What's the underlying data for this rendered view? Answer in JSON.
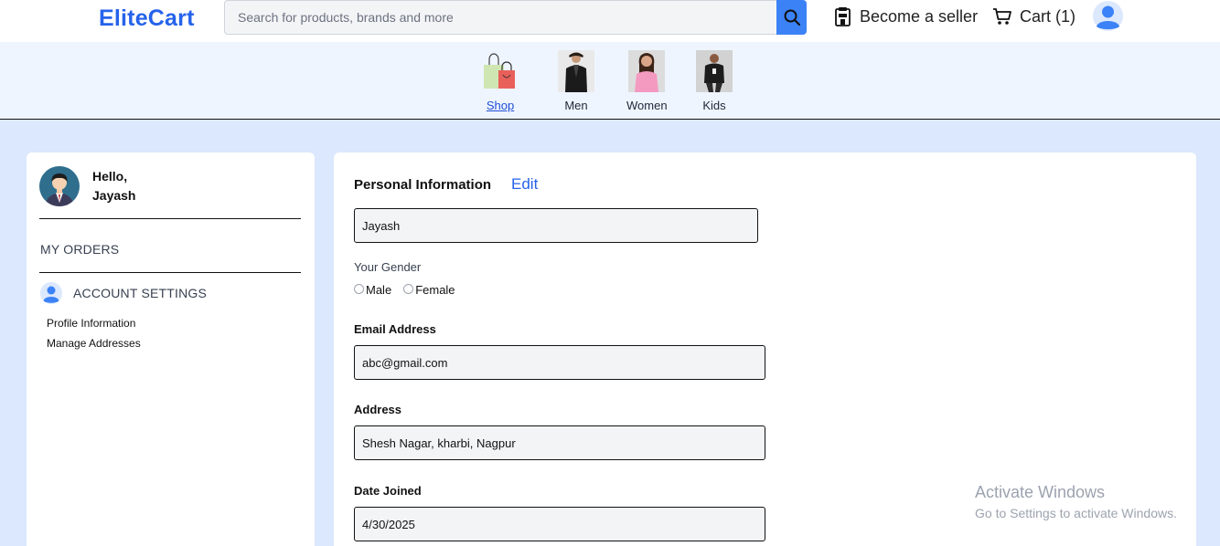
{
  "header": {
    "logo": "EliteCart",
    "search_placeholder": "Search for products, brands and more",
    "seller_label": "Become a seller",
    "cart_label": "Cart (1)"
  },
  "categories": [
    {
      "label": "Shop",
      "active": true
    },
    {
      "label": "Men"
    },
    {
      "label": "Women"
    },
    {
      "label": "Kids"
    }
  ],
  "sidebar": {
    "greeting": "Hello,",
    "username": "Jayash",
    "my_orders": "MY ORDERS",
    "account_settings": "ACCOUNT SETTINGS",
    "items": [
      {
        "label": "Profile Information"
      },
      {
        "label": "Manage Addresses"
      }
    ]
  },
  "profile": {
    "title": "Personal Information",
    "edit_label": "Edit",
    "name_value": "Jayash",
    "gender_label": "Your Gender",
    "gender_options": [
      "Male",
      "Female"
    ],
    "email_label": "Email Address",
    "email_value": "abc@gmail.com",
    "address_label": "Address",
    "address_value": "Shesh Nagar, kharbi, Nagpur",
    "date_label": "Date Joined",
    "date_value": "4/30/2025"
  },
  "watermark": {
    "line1": "Activate Windows",
    "line2": "Go to Settings to activate Windows."
  },
  "colors": {
    "brand": "#2563eb",
    "page_bg": "#dbe8fd",
    "search_button": "#3b82f6"
  }
}
